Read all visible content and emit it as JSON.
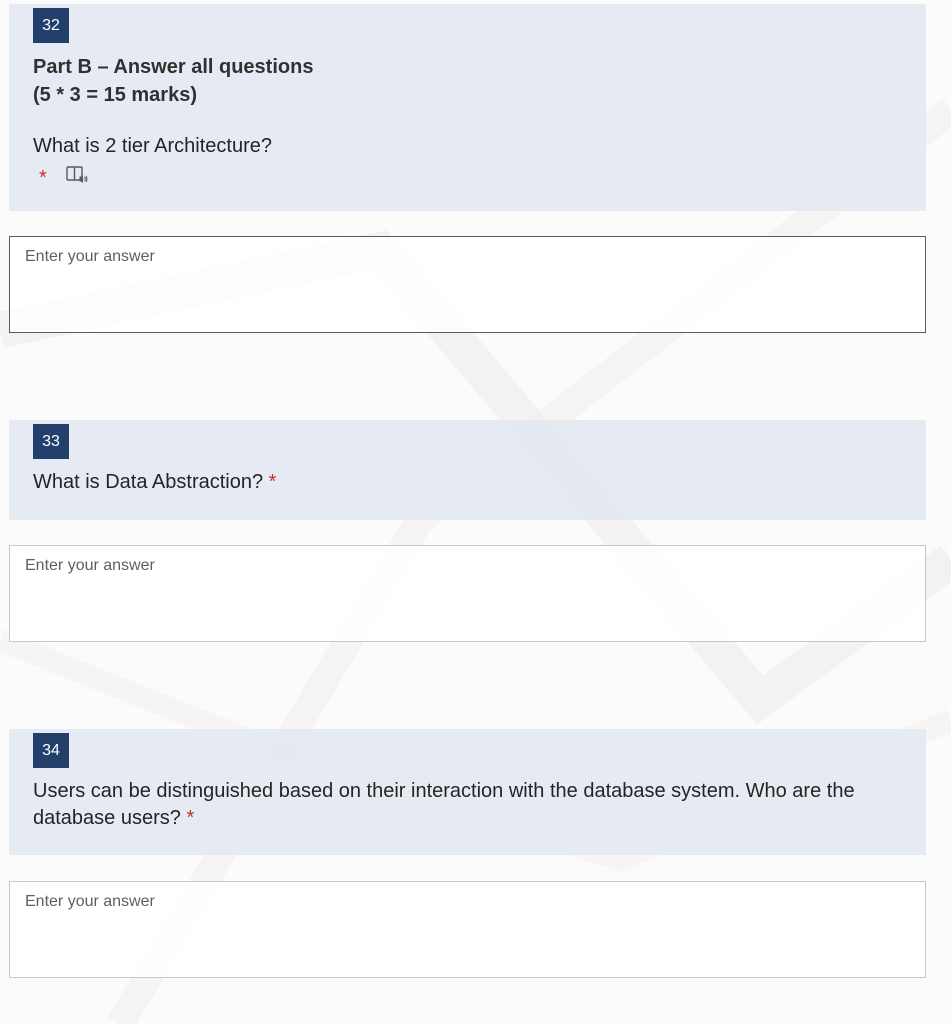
{
  "section": {
    "title": "Part B – Answer all questions",
    "marks": "(5 * 3 = 15 marks)"
  },
  "required_marker": "*",
  "icons": {
    "immersive_reader": "immersive-reader-icon"
  },
  "colors": {
    "question_number_bg": "#233f6c",
    "question_panel_bg": "#e4e9f2",
    "required": "#c4312b"
  },
  "questions": [
    {
      "number": "32",
      "text": "What is 2 tier Architecture?",
      "answer": {
        "placeholder": "Enter your answer",
        "value": ""
      }
    },
    {
      "number": "33",
      "text": "What is Data Abstraction?",
      "answer": {
        "placeholder": "Enter your answer",
        "value": ""
      }
    },
    {
      "number": "34",
      "text": "Users can be distinguished based on their interaction with the database system. Who are the database users?",
      "answer": {
        "placeholder": "Enter your answer",
        "value": ""
      }
    }
  ]
}
